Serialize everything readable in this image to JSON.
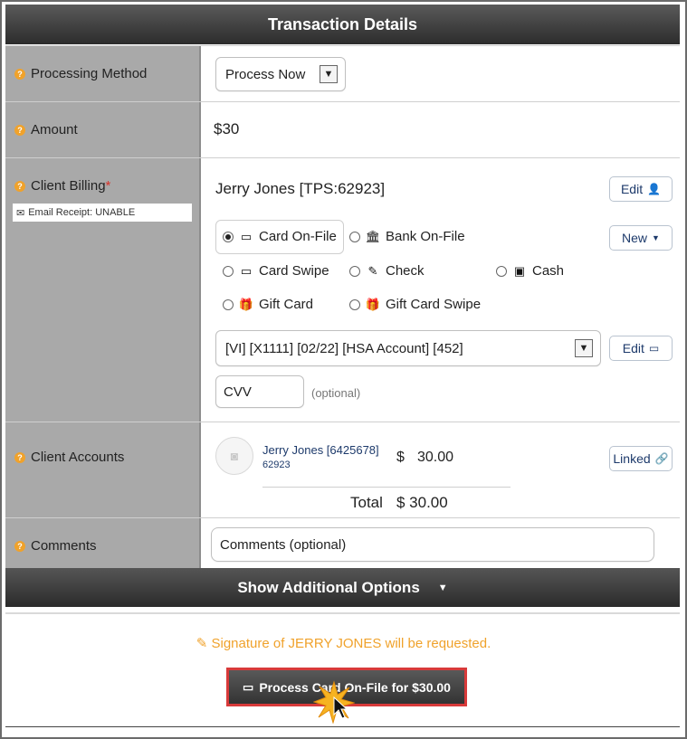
{
  "header": {
    "title": "Transaction Details"
  },
  "processing_method": {
    "label": "Processing Method",
    "value": "Process Now"
  },
  "amount": {
    "label": "Amount",
    "value": "$30"
  },
  "client_billing": {
    "label": "Client Billing",
    "required_mark": "*",
    "email_receipt": "Email Receipt: UNABLE",
    "client_name": "Jerry Jones [TPS:62923]",
    "edit_label": "Edit",
    "new_label": "New",
    "payment_options": [
      {
        "label": "Card On-File",
        "icon": "credit-card-icon",
        "selected": true
      },
      {
        "label": "Bank On-File",
        "icon": "bank-icon",
        "selected": false
      },
      {
        "label": "Card Swipe",
        "icon": "credit-card-icon",
        "selected": false
      },
      {
        "label": "Check",
        "icon": "pencil-icon",
        "selected": false
      },
      {
        "label": "Cash",
        "icon": "cash-icon",
        "selected": false
      },
      {
        "label": "Gift Card",
        "icon": "gift-icon",
        "selected": false
      },
      {
        "label": "Gift Card Swipe",
        "icon": "gift-icon",
        "selected": false
      }
    ],
    "card_select": "[VI] [X1111] [02/22] [HSA Account] [452]",
    "card_edit_label": "Edit",
    "cvv_value": "CVV",
    "cvv_hint": "(optional)"
  },
  "client_accounts": {
    "label": "Client Accounts",
    "account_name": "Jerry Jones [6425678]",
    "account_id": "62923",
    "currency": "$",
    "amount": "30.00",
    "linked_label": "Linked",
    "total_label": "Total",
    "total_value": "$ 30.00"
  },
  "comments": {
    "label": "Comments",
    "placeholder": "Comments (optional)"
  },
  "show_options": {
    "label": "Show Additional Options"
  },
  "signature_note": "Signature of JERRY JONES will be requested.",
  "process_button": {
    "label": "Process Card On-File for $30.00"
  },
  "colors": {
    "accent": "#f0a22b",
    "highlight_border": "#d83a3a",
    "header_bg": "#3a3a3a",
    "label_bg": "#a9a9a9"
  }
}
